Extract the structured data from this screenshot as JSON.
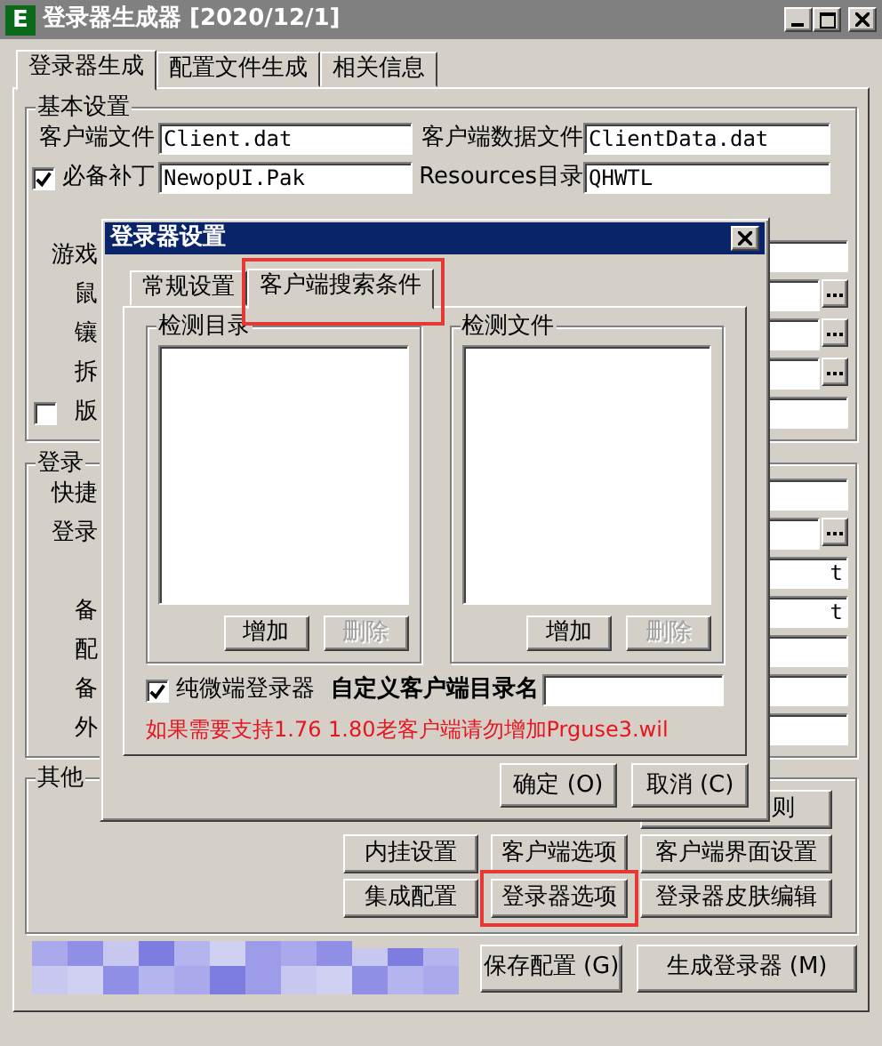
{
  "window": {
    "title": "登录器生成器 [2020/12/1]",
    "icon_letter": "E"
  },
  "tabs": [
    {
      "label": "登录器生成",
      "selected": true
    },
    {
      "label": "配置文件生成",
      "selected": false
    },
    {
      "label": "相关信息",
      "selected": false
    }
  ],
  "basic_settings": {
    "title": "基本设置",
    "rows": [
      {
        "kind": "pair",
        "left_label": "客户端文件",
        "left_value": "Client.dat",
        "right_label": "客户端数据文件",
        "right_value": "ClientData.dat"
      },
      {
        "kind": "check_pair",
        "checked": true,
        "left_label": "必备补丁",
        "left_value": "NewopUI.Pak",
        "right_label": "Resources目录",
        "right_value": "QHWTL"
      },
      {
        "kind": "obscured"
      },
      {
        "kind": "covered",
        "label": "游戏",
        "browse": false
      },
      {
        "kind": "covered",
        "label": "鼠",
        "browse": true
      },
      {
        "kind": "covered",
        "label": "镶",
        "browse": true
      },
      {
        "kind": "covered",
        "label": "拆",
        "browse": true
      },
      {
        "kind": "covered_check",
        "label": "版",
        "checked": false,
        "browse": false
      }
    ]
  },
  "launcher_settings": {
    "title": "登录",
    "rows": [
      {
        "kind": "covered",
        "label": "快捷",
        "browse": false
      },
      {
        "kind": "covered",
        "label": "登录",
        "browse": true
      },
      {
        "kind": "covered",
        "value_tail": "t",
        "browse": false
      },
      {
        "kind": "covered",
        "label": "备",
        "value_tail": "t",
        "browse": false
      },
      {
        "kind": "covered",
        "label": "配",
        "browse": false
      },
      {
        "kind": "covered",
        "label": "备",
        "browse": false
      },
      {
        "kind": "covered",
        "label": "外",
        "browse": false
      }
    ]
  },
  "other_settings": {
    "title": "其他",
    "button_rows": [
      [
        {
          "label": "则",
          "highlighted": false
        }
      ],
      [
        {
          "label": "内挂设置",
          "highlighted": false
        },
        {
          "label": "客户端选项",
          "highlighted": false
        },
        {
          "label": "客户端界面设置",
          "highlighted": false
        }
      ],
      [
        {
          "label": "集成配置",
          "highlighted": false
        },
        {
          "label": "登录器选项",
          "highlighted": true
        },
        {
          "label": "登录器皮肤编辑",
          "highlighted": false
        }
      ]
    ]
  },
  "blurred_region": {
    "kind": "picture"
  },
  "footer_buttons": [
    "保存配置 (G)",
    "生成登录器 (M)"
  ],
  "dialog": {
    "title": "登录器设置",
    "tabs": [
      {
        "label": "常规设置",
        "selected": false,
        "highlighted": false
      },
      {
        "label": "客户端搜索条件",
        "selected": true,
        "highlighted": true
      }
    ],
    "groups": [
      {
        "title": "检测目录",
        "buttons": [
          {
            "label": "增加",
            "disabled": false
          },
          {
            "label": "删除",
            "disabled": true
          }
        ]
      },
      {
        "title": "检测文件",
        "buttons": [
          {
            "label": "增加",
            "disabled": false
          },
          {
            "label": "删除",
            "disabled": true
          }
        ]
      }
    ],
    "micro_client": {
      "label": "纯微端登录器",
      "checked": true
    },
    "custom_dir": {
      "label": "自定义客户端目录名"
    },
    "warning": "如果需要支持1.76 1.80老客户端请勿增加Prguse3.wil",
    "buttons": [
      "确定 (O)",
      "取消 (C)"
    ]
  }
}
